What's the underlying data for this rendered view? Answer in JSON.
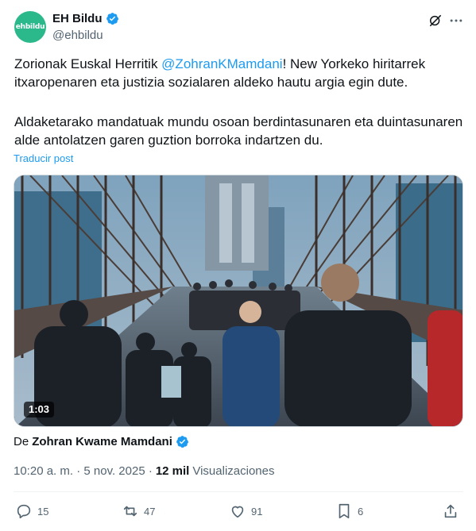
{
  "tweet": {
    "avatar_text": "ehbildu",
    "display_name": "EH Bildu",
    "handle": "@ehbildu",
    "text_part1": "Zorionak Euskal Herritik ",
    "mention": "@ZohranKMamdani",
    "text_part2": "! New Yorkeko hiritarrek itxaropenaren eta justizia sozialaren aldeko hautu argia egin dute.",
    "paragraph2": "Aldaketarako mandatuak mundu osoan berdintasunaren eta duintasunaren alde antolatzen garen guztion borroka indartzen du.",
    "translate_label": "Traducir post",
    "video_duration": "1:03",
    "attribution_prefix": "De",
    "attribution_author": "Zohran Kwame Mamdani",
    "timestamp": "10:20 a. m. · 5 nov. 2025 ·",
    "views_count": "12 mil",
    "views_label": "Visualizaciones",
    "replies": "15",
    "reposts": "47",
    "likes": "91",
    "bookmarks": "6"
  },
  "icons": {
    "verified": "verified-badge-icon",
    "grok": "grok-icon",
    "more": "more-icon",
    "reply": "reply-icon",
    "repost": "repost-icon",
    "like": "like-icon",
    "bookmark": "bookmark-icon",
    "share": "share-icon"
  },
  "colors": {
    "accent": "#1d9bf0",
    "avatar_bg": "#2bb88a",
    "secondary_text": "#536471"
  }
}
